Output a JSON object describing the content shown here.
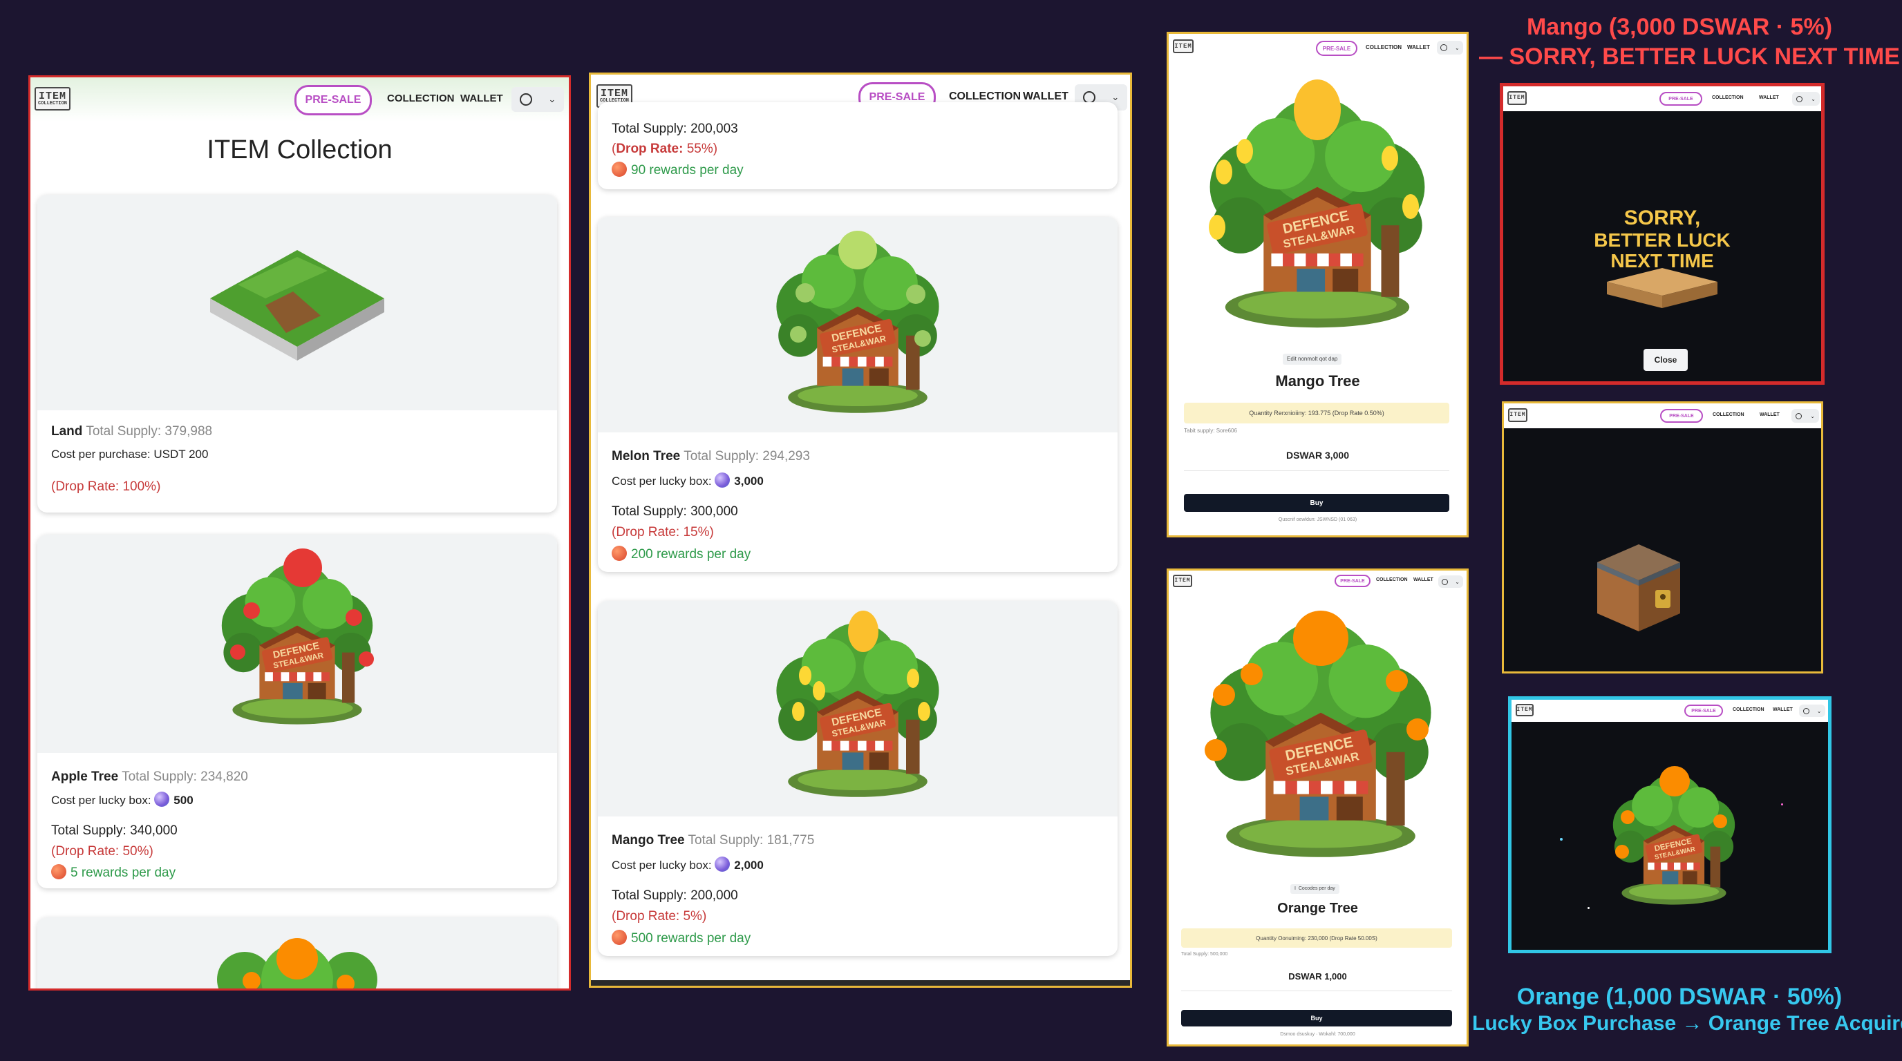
{
  "colors": {
    "background": "#1c1530",
    "accent": "#b84ec4",
    "red_frame": "#d42b2b",
    "yellow_frame": "#e8b93a",
    "cyan_frame": "#31c6e6",
    "drop_rate": "#c73a3a",
    "rewards": "#2e9a4a"
  },
  "nav": {
    "logo_top": "ITEM",
    "logo_bottom": "COLLECTION",
    "presale": "PRE-SALE",
    "collection": "COLLECTION",
    "wallet": "WALLET",
    "account_icon": "user-circle-icon",
    "chevron_icon": "chevron-down-icon"
  },
  "panel1": {
    "title": "ITEM Collection",
    "land": {
      "name": "Land",
      "supply": "Total Supply: 379,988",
      "cost_label": "Cost per purchase:",
      "cost_value": "USDT 200",
      "drop": "(Drop Rate: 100%)"
    },
    "apple": {
      "name": "Apple Tree",
      "supply": "Total Supply: 234,820",
      "cost_label": "Cost per lucky box:",
      "cost_value": "500",
      "total": "Total Supply: 340,000",
      "drop": "(Drop Rate: 50%)",
      "rewards": "5 rewards per day"
    }
  },
  "panel2": {
    "top": {
      "total": "Total Supply: 200,003",
      "drop_prefix": "(",
      "drop_bold": "Drop Rate:",
      "drop_rest": " 55%)",
      "rewards": "90 rewards per day"
    },
    "melon": {
      "name": "Melon Tree",
      "supply": "Total Supply: 294,293",
      "cost_label": "Cost per lucky box:",
      "cost_value": "3,000",
      "total": "Total Supply: 300,000",
      "drop": "(Drop Rate: 15%)",
      "rewards": "200 rewards per day"
    },
    "mango": {
      "name": "Mango Tree",
      "supply": "Total Supply: 181,775",
      "cost_label": "Cost per lucky box:",
      "cost_value": "2,000",
      "total": "Total Supply: 200,000",
      "drop": "(Drop Rate: 5%)",
      "rewards": "500 rewards per day"
    }
  },
  "panel3": {
    "badge": "Edit nonmolt qot dap",
    "name": "Mango Tree",
    "quantity": "Quantity Rerxnioiiny: 193.775 (Drop Rate 0.50%)",
    "supply_small": "Tabit supply: Sore606",
    "price": "DSWAR 3,000",
    "buy": "Buy",
    "footer": "Quscnif oewldun: JSWNSD (01 063)"
  },
  "panel4": {
    "badge": "I  Cocodes per day",
    "name": "Orange Tree",
    "quantity": "Quantity Oonuiming: 230,000 (Drop Rate 50.00S)",
    "supply_small": "Total Supply: 500,000",
    "price": "DSWAR 1,000",
    "buy": "Buy",
    "footer": "Dsmoo dsuskuy · Wokahl: 700,000"
  },
  "panel5": {
    "line1": "SORRY,",
    "line2": "BETTER LUCK",
    "line3": "NEXT TIME",
    "close": "Close"
  },
  "caption_top": {
    "line1": "Mango (3,000 DSWAR · 5%)",
    "line2": "— SORRY, BETTER LUCK NEXT TIME"
  },
  "caption_bottom": {
    "line1": "Orange (1,000 DSWAR · 50%)",
    "line2": "Lucky Box Purchase → Orange Tree Acquired!"
  }
}
